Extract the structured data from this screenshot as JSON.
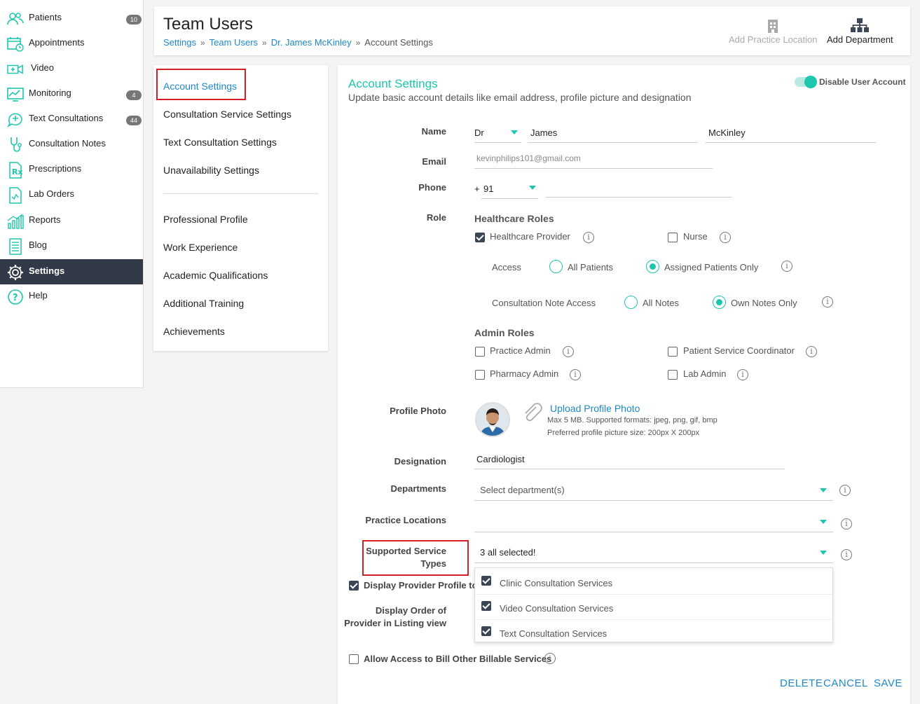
{
  "sidebar": {
    "items": [
      {
        "label": "Patients",
        "icon": "patients-icon",
        "badge": "10"
      },
      {
        "label": "Appointments",
        "icon": "calendar-icon",
        "badge": ""
      },
      {
        "label": "Video",
        "icon": "video-icon",
        "badge": ""
      },
      {
        "label": "Monitoring",
        "icon": "monitoring-icon",
        "badge": "4"
      },
      {
        "label": "Text Consultations",
        "icon": "chat-icon",
        "badge": "44"
      },
      {
        "label": "Consultation Notes",
        "icon": "stethoscope-icon",
        "badge": ""
      },
      {
        "label": "Prescriptions",
        "icon": "prescription-icon",
        "badge": ""
      },
      {
        "label": "Lab Orders",
        "icon": "lab-orders-icon",
        "badge": ""
      },
      {
        "label": "Reports",
        "icon": "reports-icon",
        "badge": ""
      },
      {
        "label": "Blog",
        "icon": "blog-icon",
        "badge": ""
      },
      {
        "label": "Settings",
        "icon": "gear-icon",
        "badge": ""
      },
      {
        "label": "Help",
        "icon": "help-icon",
        "badge": ""
      }
    ],
    "active": "Settings"
  },
  "header": {
    "title": "Team Users",
    "breadcrumb": [
      "Settings",
      "Team Users",
      "Dr. James McKinley",
      "Account Settings"
    ],
    "add_location": "Add Practice Location",
    "add_department": "Add Department"
  },
  "submenu": {
    "group1": [
      "Account Settings",
      "Consultation Service Settings",
      "Text Consultation Settings",
      "Unavailability Settings"
    ],
    "group2": [
      "Professional Profile",
      "Work Experience",
      "Academic Qualifications",
      "Additional Training",
      "Achievements"
    ]
  },
  "account": {
    "title": "Account Settings",
    "subtitle": "Update basic account details like email address, profile picture and designation",
    "disable_label": "Disable User Account",
    "labels": {
      "name": "Name",
      "email": "Email",
      "phone": "Phone",
      "role": "Role",
      "profile_photo": "Profile Photo",
      "designation": "Designation",
      "departments": "Departments",
      "practice_locations": "Practice Locations",
      "supported_service_types_1": "Supported Service",
      "supported_service_types_2": "Types",
      "display_order_1": "Display Order of",
      "display_order_2": "Provider in Listing view"
    },
    "name_prefix": "Dr",
    "first_name": "James",
    "last_name": "McKinley",
    "email": "kevinphilips101@gmail.com",
    "phone_plus": "+",
    "phone_code": "91",
    "healthcare_roles_title": "Healthcare Roles",
    "healthcare_provider": "Healthcare Provider",
    "nurse": "Nurse",
    "access_label": "Access",
    "all_patients": "All Patients",
    "assigned_patients": "Assigned Patients Only",
    "note_access_label": "Consultation Note Access",
    "all_notes": "All Notes",
    "own_notes": "Own Notes Only",
    "admin_roles_title": "Admin Roles",
    "practice_admin": "Practice Admin",
    "patient_service_coordinator": "Patient Service Coordinator",
    "pharmacy_admin": "Pharmacy Admin",
    "lab_admin": "Lab Admin",
    "upload_photo": "Upload Profile Photo",
    "photo_hint1": "Max 5 MB. Supported formats: jpeg, png, gif, bmp",
    "photo_hint2": "Preferred profile picture size: 200px X 200px",
    "designation": "Cardiologist",
    "departments_placeholder": "Select department(s)",
    "service_types_value": "3 all selected!",
    "service_options": [
      "Clinic Consultation Services",
      "Video Consultation Services",
      "Text Consultation Services"
    ],
    "display_profile": "Display Provider Profile to I",
    "allow_bill": "Allow Access to Bill Other Billable Services",
    "delete": "DELETE",
    "cancel": "CANCEL",
    "save": "SAVE"
  },
  "colors": {
    "accent": "#1bc7ae",
    "link": "#1e88c7",
    "sidebar_active": "#323a47",
    "highlight_box": "#d32027"
  }
}
